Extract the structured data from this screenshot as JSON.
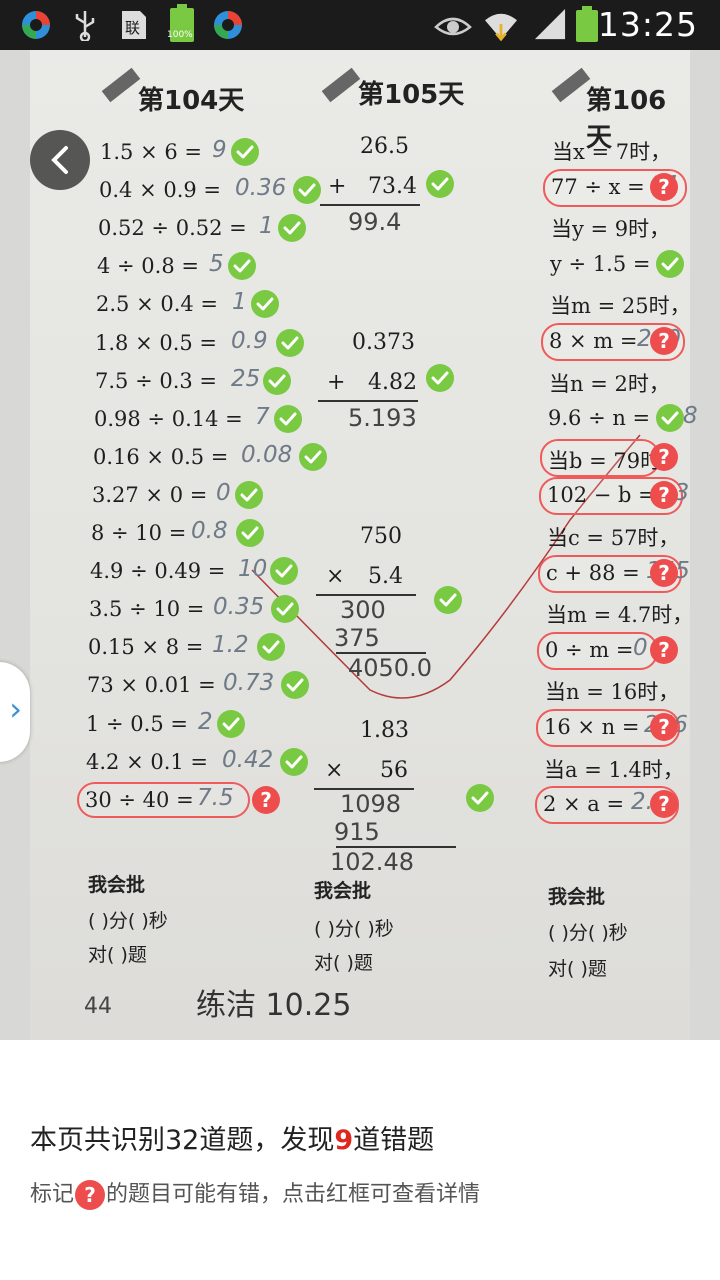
{
  "status_bar": {
    "time": "13:25",
    "battery_label": "100%",
    "icons": [
      "app-icon",
      "usb-icon",
      "sim-icon",
      "battery-full-icon",
      "app-icon",
      "eye-icon",
      "wifi-icon",
      "signal-icon",
      "battery-icon"
    ]
  },
  "worksheet": {
    "col1": {
      "header": "第104天",
      "equations": [
        {
          "q": "1.5 × 6 =",
          "a": "9",
          "mark": "check"
        },
        {
          "q": "0.4 × 0.9 =",
          "a": "0.36",
          "mark": "check"
        },
        {
          "q": "0.52 ÷ 0.52 =",
          "a": "1",
          "mark": "check"
        },
        {
          "q": "4 ÷ 0.8 =",
          "a": "5",
          "mark": "check"
        },
        {
          "q": "2.5 × 0.4 =",
          "a": "1",
          "mark": "check"
        },
        {
          "q": "1.8 × 0.5 =",
          "a": "0.9",
          "mark": "check"
        },
        {
          "q": "7.5 ÷ 0.3 =",
          "a": "25",
          "mark": "check"
        },
        {
          "q": "0.98 ÷ 0.14 =",
          "a": "7",
          "mark": "check"
        },
        {
          "q": "0.16 × 0.5 =",
          "a": "0.08",
          "mark": "check"
        },
        {
          "q": "3.27 × 0 =",
          "a": "0",
          "mark": "check"
        },
        {
          "q": "8 ÷ 10 =",
          "a": "0.8",
          "mark": "check"
        },
        {
          "q": "4.9 ÷ 0.49 =",
          "a": "10",
          "mark": "check"
        },
        {
          "q": "3.5 ÷ 10 =",
          "a": "0.35",
          "mark": "check"
        },
        {
          "q": "0.15 × 8 =",
          "a": "1.2",
          "mark": "check"
        },
        {
          "q": "73 × 0.01 =",
          "a": "0.73",
          "mark": "check"
        },
        {
          "q": "1 ÷ 0.5 =",
          "a": "2",
          "mark": "check"
        },
        {
          "q": "4.2 × 0.1 =",
          "a": "0.42",
          "mark": "check"
        },
        {
          "q": "30 ÷ 40 =",
          "a": "7.5",
          "mark": "question"
        }
      ],
      "footer": {
        "title": "我会批",
        "line1": "(    )分(    )秒",
        "line2": "对(    )题"
      }
    },
    "col2": {
      "header": "第105天",
      "problems": [
        {
          "top": "26.5",
          "op": "+",
          "bottom": "73.4",
          "work": [],
          "result": "99.4"
        },
        {
          "top": "0.373",
          "op": "+",
          "bottom": "4.82",
          "work": [],
          "result": "5.193"
        },
        {
          "top": "750",
          "op": "×",
          "bottom": "5.4",
          "work": [
            "300",
            "375"
          ],
          "result": "4050.0"
        },
        {
          "top": "1.83",
          "op": "×",
          "bottom": "56",
          "work": [
            "1098",
            "915"
          ],
          "result": "102.48"
        }
      ],
      "footer": {
        "title": "我会批",
        "line1": "(    )分(    )秒",
        "line2": "对(    )题"
      }
    },
    "col3": {
      "header": "第106天",
      "lines": [
        {
          "text": "当x = 7时，",
          "answer": "",
          "mark": ""
        },
        {
          "text": "77 ÷ x =",
          "answer": "11",
          "mark": "question"
        },
        {
          "text": "当y = 9时，",
          "answer": "",
          "mark": ""
        },
        {
          "text": "y ÷ 1.5 =",
          "answer": "6",
          "mark": "check"
        },
        {
          "text": "当m = 25时，",
          "answer": "",
          "mark": ""
        },
        {
          "text": "8 × m =",
          "answer": "200",
          "mark": "question"
        },
        {
          "text": "当n = 2时，",
          "answer": "",
          "mark": ""
        },
        {
          "text": "9.6 ÷ n =",
          "answer": "4.8",
          "mark": "check"
        },
        {
          "text": "当b = 79时",
          "answer": "",
          "mark": "question"
        },
        {
          "text": "102 − b =",
          "answer": "23",
          "mark": "question"
        },
        {
          "text": "当c = 57时，",
          "answer": "",
          "mark": ""
        },
        {
          "text": "c + 88 =",
          "answer": "145",
          "mark": "question"
        },
        {
          "text": "当m = 4.7时，",
          "answer": "",
          "mark": ""
        },
        {
          "text": "0 ÷ m =",
          "answer": "0",
          "mark": "question"
        },
        {
          "text": "当n = 16时，",
          "answer": "",
          "mark": ""
        },
        {
          "text": "16 × n =",
          "answer": "256",
          "mark": "question"
        },
        {
          "text": "当a = 1.4时，",
          "answer": "",
          "mark": ""
        },
        {
          "text": "2 × a =",
          "answer": "2.8",
          "mark": "question"
        }
      ],
      "footer": {
        "title": "我会批",
        "line1": "(    )分(    )秒",
        "line2": "对(    )题"
      }
    },
    "page_number": "44",
    "signature": "练洁 10.25"
  },
  "summary": {
    "prefix": "本页共识别32道题，发现",
    "error_count": "9",
    "suffix": "道错题"
  },
  "hint": {
    "prefix": "标记",
    "icon_text": "?",
    "suffix": "的题目可能有错，点击红框可查看详情"
  },
  "colors": {
    "check": "#7ac943",
    "question": "#ee4d4d",
    "error_count": "#e0271e"
  }
}
